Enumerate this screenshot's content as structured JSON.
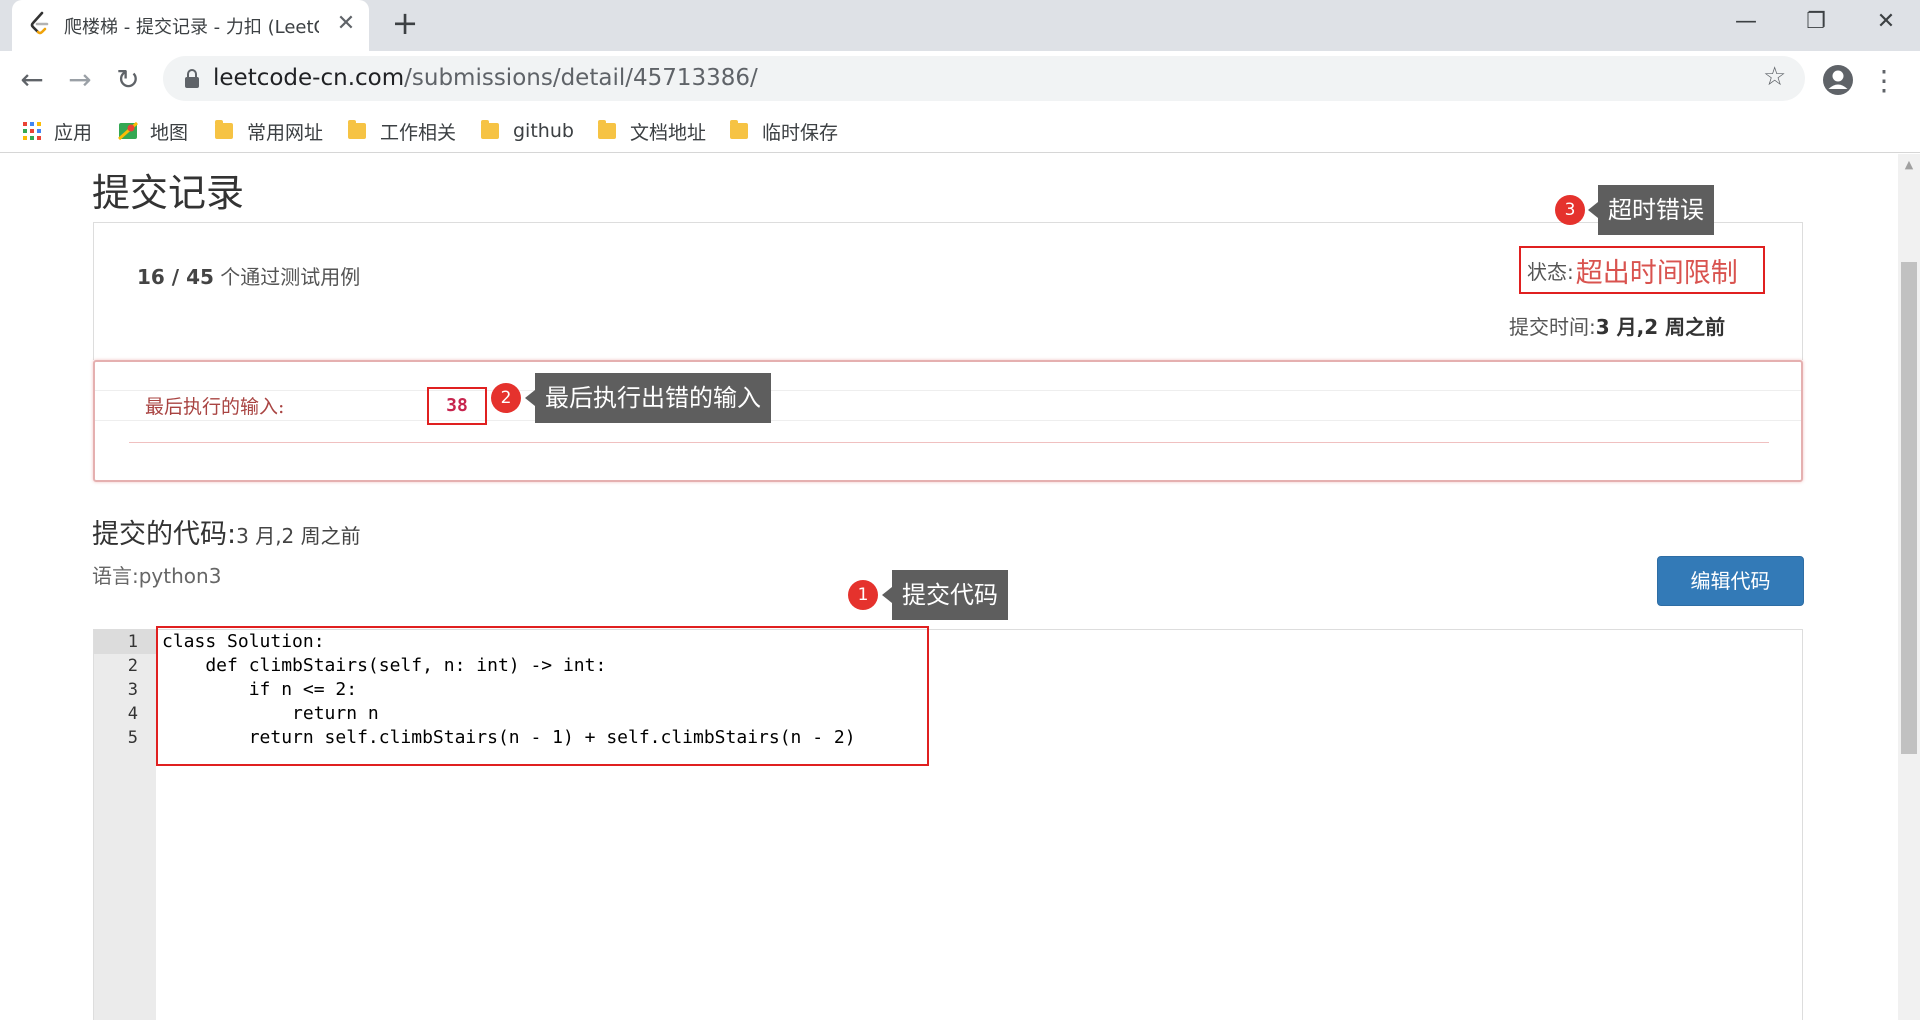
{
  "browser": {
    "tab_title": "爬楼梯 - 提交记录 - 力扣 (LeetCode)",
    "tab_close": "✕",
    "new_tab": "+",
    "window_minimize": "—",
    "window_restore": "❐",
    "window_close": "✕",
    "back": "←",
    "forward": "→",
    "reload": "↻",
    "url_host": "leetcode-cn.com",
    "url_path": "/submissions/detail/45713386/",
    "star": "☆",
    "menu": "⋮"
  },
  "bookmarks": [
    {
      "label": "应用",
      "icon": "apps-grid-icon"
    },
    {
      "label": "地图",
      "icon": "maps-icon"
    },
    {
      "label": "常用网址",
      "icon": "folder-icon"
    },
    {
      "label": "工作相关",
      "icon": "folder-icon"
    },
    {
      "label": "github",
      "icon": "folder-icon"
    },
    {
      "label": "文档地址",
      "icon": "folder-icon"
    },
    {
      "label": "临时保存",
      "icon": "folder-icon"
    }
  ],
  "page": {
    "title": "提交记录",
    "pass_count_bold": "16 / 45",
    "pass_count_text": " 个通过测试用例",
    "status_label": "状态:",
    "status_value": "超出时间限制",
    "submit_time_label": "提交时间:",
    "submit_time_value": "3 月,2 周之前",
    "error_label": "最后执行的输入:",
    "error_input": "38",
    "code_heading": "提交的代码:",
    "code_heading_time": "3 月,2 周之前",
    "language": "语言:python3",
    "edit_button": "编辑代码",
    "status_color": "#d9534f",
    "button_color": "#337ab7"
  },
  "code": {
    "line_numbers": [
      "1",
      "2",
      "3",
      "4",
      "5"
    ],
    "lines": [
      "class Solution:",
      "    def climbStairs(self, n: int) -> int:",
      "        if n <= 2:",
      "            return n",
      "        return self.climbStairs(n - 1) + self.climbStairs(n - 2)"
    ]
  },
  "annotations": [
    {
      "number": "1",
      "text": "提交代码"
    },
    {
      "number": "2",
      "text": "最后执行出错的输入"
    },
    {
      "number": "3",
      "text": "超时错误"
    }
  ]
}
